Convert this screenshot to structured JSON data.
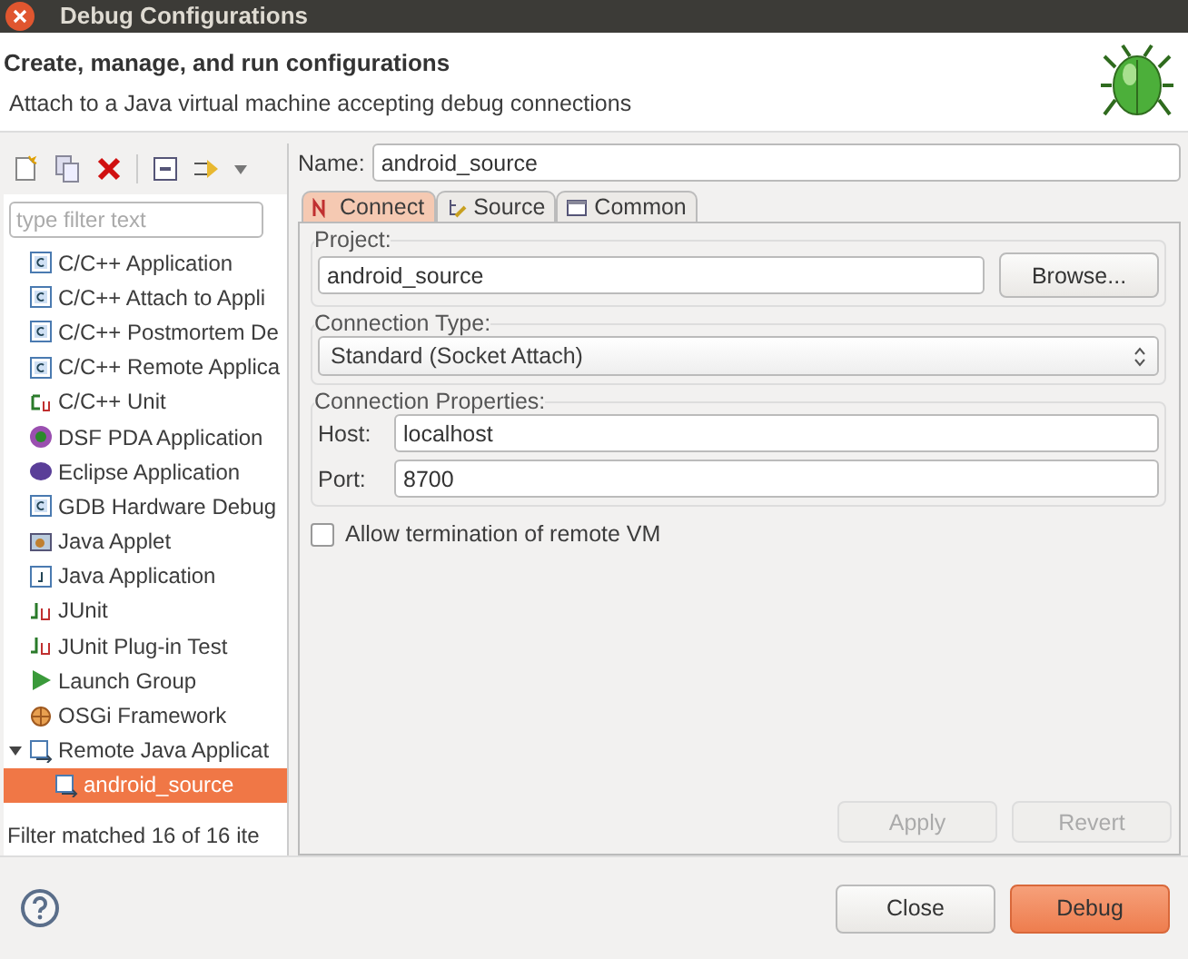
{
  "window": {
    "title": "Debug Configurations"
  },
  "header": {
    "title": "Create, manage, and run configurations",
    "message": "Attach to a Java virtual machine accepting debug connections"
  },
  "toolbar": [
    {
      "kind": "new"
    },
    {
      "kind": "duplicate"
    },
    {
      "kind": "delete"
    },
    {
      "kind": "collapse"
    },
    {
      "kind": "filter"
    }
  ],
  "filter": {
    "placeholder": "type filter text"
  },
  "tree": [
    {
      "label": "C/C++ Application",
      "kind": "c",
      "selected": false
    },
    {
      "label": "C/C++ Attach to Appli",
      "kind": "c",
      "selected": false
    },
    {
      "label": "C/C++ Postmortem De",
      "kind": "c",
      "selected": false
    },
    {
      "label": "C/C++ Remote Applica",
      "kind": "c",
      "selected": false
    },
    {
      "label": "C/C++ Unit",
      "kind": "cunit",
      "selected": false
    },
    {
      "label": "DSF PDA Application",
      "kind": "dsf",
      "selected": false
    },
    {
      "label": "Eclipse Application",
      "kind": "eclipse",
      "selected": false
    },
    {
      "label": "GDB Hardware Debug",
      "kind": "c",
      "selected": false
    },
    {
      "label": "Java Applet",
      "kind": "applet",
      "selected": false
    },
    {
      "label": "Java Application",
      "kind": "java",
      "selected": false
    },
    {
      "label": "JUnit",
      "kind": "junit",
      "selected": false
    },
    {
      "label": "JUnit Plug-in Test",
      "kind": "junit",
      "selected": false
    },
    {
      "label": "Launch Group",
      "kind": "launch",
      "selected": false
    },
    {
      "label": "OSGi Framework",
      "kind": "osgi",
      "selected": false
    },
    {
      "label": "Remote Java Applicat",
      "kind": "remote",
      "selected": false,
      "expanded": true,
      "children": [
        {
          "label": "android_source",
          "kind": "remote",
          "selected": true
        }
      ]
    }
  ],
  "filter_status": "Filter matched 16 of 16 ite",
  "name": {
    "label": "Name:",
    "value": "android_source"
  },
  "tabs": [
    {
      "label": "Connect",
      "kind": "connect",
      "selected": true
    },
    {
      "label": "Source",
      "kind": "source",
      "selected": false
    },
    {
      "label": "Common",
      "kind": "common",
      "selected": false
    }
  ],
  "project": {
    "group": "Project:",
    "value": "android_source",
    "button": "Browse..."
  },
  "connection_type": {
    "group": "Connection Type:",
    "value": "Standard (Socket Attach)"
  },
  "connection_properties": {
    "group": "Connection Properties:",
    "fields": [
      {
        "label": "Host:",
        "value": "localhost"
      },
      {
        "label": "Port:",
        "value": "8700"
      }
    ]
  },
  "allow_termination": {
    "label": "Allow termination of remote VM",
    "checked": false
  },
  "panel_buttons": [
    {
      "label": "Apply",
      "disabled": true
    },
    {
      "label": "Revert",
      "disabled": true
    }
  ],
  "dialog_buttons": [
    {
      "label": "Close",
      "default": false
    },
    {
      "label": "Debug",
      "default": true
    }
  ]
}
